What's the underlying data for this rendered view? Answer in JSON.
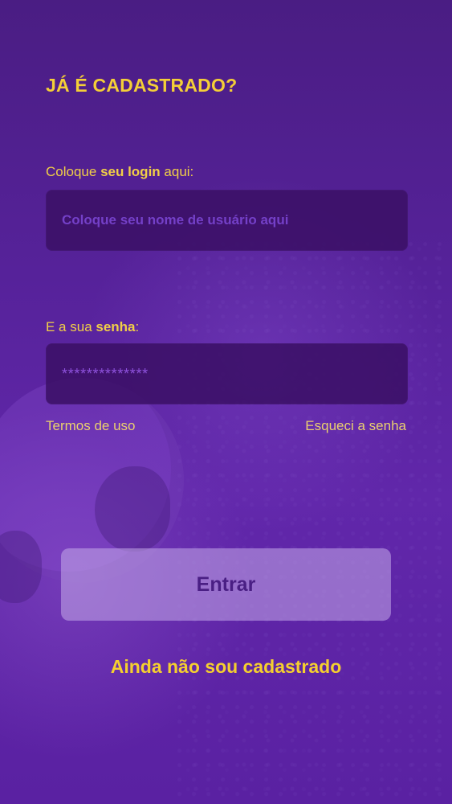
{
  "login": {
    "title": "JÁ É CADASTRADO?",
    "username": {
      "label_before": "Coloque ",
      "label_emphasis": "seu login",
      "label_after": " aqui:",
      "placeholder": "Coloque seu nome de usuário aqui",
      "value": ""
    },
    "password": {
      "label_before": "E a sua ",
      "label_emphasis": "senha",
      "label_after": ":",
      "placeholder": "**************",
      "value": ""
    },
    "links": {
      "terms": "Termos de uso",
      "forgot_password": "Esqueci a senha",
      "signup": "Ainda não sou cadastrado"
    },
    "buttons": {
      "submit": "Entrar"
    }
  },
  "theme": {
    "background": "#5a21a2",
    "accent": "#f4cf37",
    "input_background": "#3b1067",
    "button_background": "#cab0ec"
  },
  "background": {
    "decorative_icon": "soccer-ball"
  }
}
